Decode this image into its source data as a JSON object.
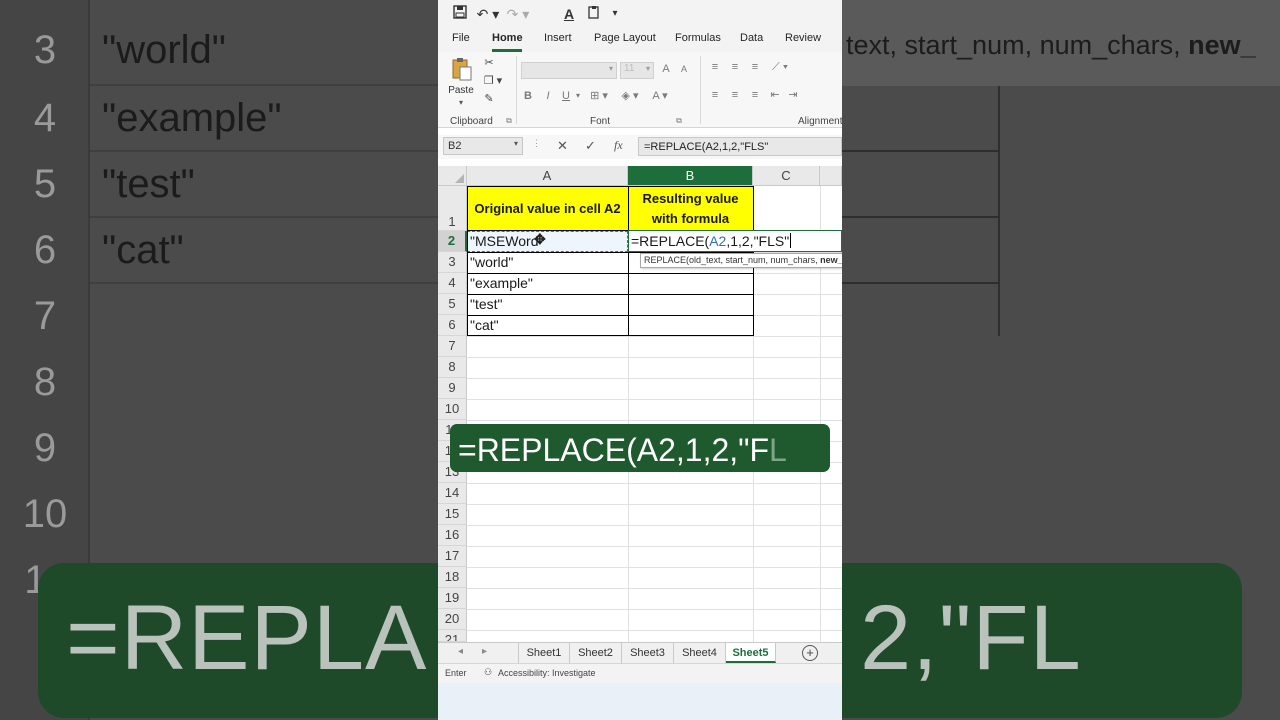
{
  "ribbon": {
    "tabs": [
      "File",
      "Home",
      "Insert",
      "Page Layout",
      "Formulas",
      "Data",
      "Review"
    ],
    "active_tab": "Home",
    "paste_label": "Paste",
    "groups": {
      "clipboard": "Clipboard",
      "font": "Font",
      "alignment": "Alignment"
    },
    "font_size": "11",
    "bold": "B",
    "italic": "I",
    "underline": "U"
  },
  "formula_bar": {
    "name_box": "B2",
    "cancel": "✕",
    "enter": "✓",
    "fx": "fx",
    "formula": "=REPLACE(A2,1,2,\"FLS\""
  },
  "grid": {
    "columns": [
      "A",
      "B",
      "C"
    ],
    "active_column": "B",
    "rows": [
      "1",
      "2",
      "3",
      "4",
      "5",
      "6",
      "7",
      "8",
      "9",
      "10",
      "11",
      "12",
      "13",
      "14",
      "15",
      "16",
      "17",
      "18",
      "19",
      "20",
      "21"
    ],
    "active_row": "2",
    "header_a": "Original value in cell A2",
    "header_b_line1": "Resulting value",
    "header_b_line2": "with formula",
    "values": [
      "\"MSEWord\"",
      "\"world\"",
      "\"example\"",
      "\"test\"",
      "\"cat\""
    ],
    "edit_prefix": "=REPLACE(",
    "edit_ref": "A2",
    "edit_suffix": ",1,2,\"FLS\"",
    "tooltip_text": "REPLACE(old_text, start_num, num_chars, ",
    "tooltip_bold": "new_text"
  },
  "overlay": {
    "caption_main": "=REPLACE(A2,1,2,\"F",
    "caption_faint": "L"
  },
  "sheets": {
    "tabs": [
      "Sheet1",
      "Sheet2",
      "Sheet3",
      "Sheet4",
      "Sheet5"
    ],
    "active": "Sheet5",
    "add": "+"
  },
  "status": {
    "mode": "Enter",
    "accessibility": "Accessibility: Investigate"
  },
  "background": {
    "row_numbers": [
      "3",
      "4",
      "5",
      "6",
      "7",
      "8",
      "9",
      "10",
      "11"
    ],
    "values": [
      "\"world\"",
      "\"example\"",
      "\"test\"",
      "\"cat\""
    ],
    "right_text": "text, start_num, num_chars, ",
    "right_text_bold": "new_",
    "banner_main": "=REPLA",
    "banner_tail": "2,\"F",
    "banner_faint": "L"
  },
  "colors": {
    "excel_green": "#1e6e3c",
    "header_fill": "#ffff00",
    "ref_blue": "#2f6dbf",
    "banner_green": "#1e5a2e"
  }
}
